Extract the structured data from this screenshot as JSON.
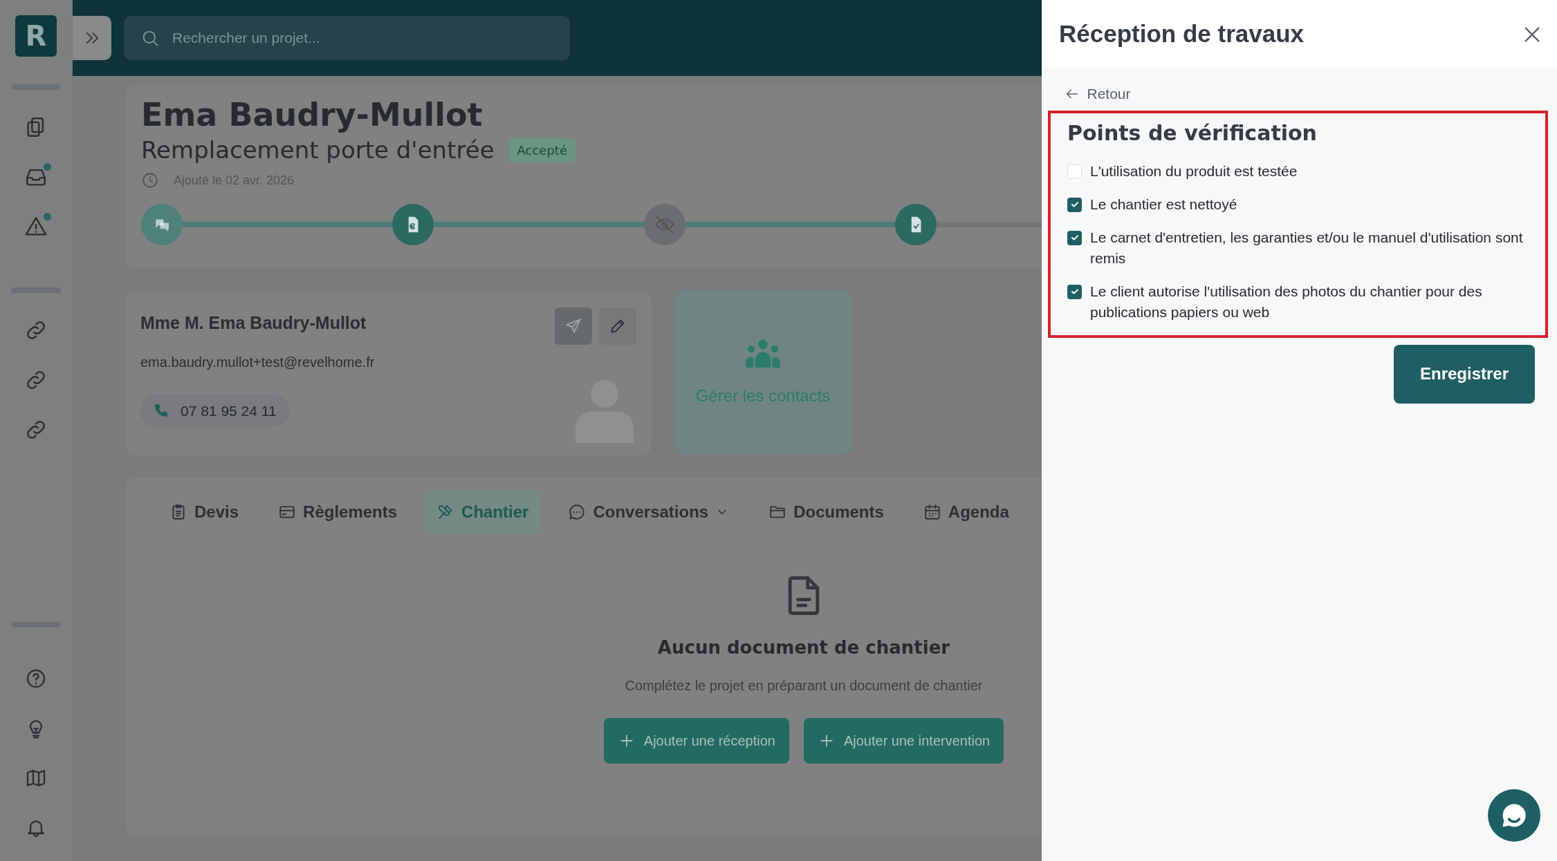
{
  "sidebar": {
    "logo": "R",
    "items": [
      {
        "notification": false
      },
      {
        "notification": true
      },
      {
        "notification": true
      },
      {
        "notification": false
      },
      {
        "notification": false
      },
      {
        "notification": false
      }
    ]
  },
  "search": {
    "placeholder": "Rechercher un projet..."
  },
  "project": {
    "client": "Ema Baudry-Mullot",
    "title": "Remplacement porte d'entrée",
    "status": "Accepté",
    "added": "Ajouté le 02 avr. 2026",
    "steps": [
      {
        "color": "#4f8178"
      },
      {
        "color": "#2a6a5f"
      },
      {
        "color": "#6b6e70"
      },
      {
        "color": "#2a6a5f"
      }
    ]
  },
  "contact": {
    "name": "Mme M. Ema Baudry-Mullot",
    "email": "ema.baudry.mullot+test@revelhome.fr",
    "phone": "07 81 95 24 11",
    "manage": "Gérer les contacts"
  },
  "tabs": [
    {
      "label": "Devis",
      "selected": false
    },
    {
      "label": "Règlements",
      "selected": false
    },
    {
      "label": "Chantier",
      "selected": true
    },
    {
      "label": "Conversations",
      "selected": false,
      "dropdown": true
    },
    {
      "label": "Documents",
      "selected": false
    },
    {
      "label": "Agenda",
      "selected": false
    }
  ],
  "empty_state": {
    "title": "Aucun document de chantier",
    "text": "Complétez le projet en préparant un document de chantier",
    "buttons": [
      "Ajouter une réception",
      "Ajouter une intervention"
    ]
  },
  "panel": {
    "title": "Réception de travaux",
    "back": "Retour",
    "section": "Points de vérification",
    "highlighted": true,
    "checks": [
      {
        "label": "L'utilisation du produit est testée",
        "checked": false
      },
      {
        "label": "Le chantier est nettoyé",
        "checked": true
      },
      {
        "label": "Le carnet d'entretien, les garanties et/ou le manuel d'utilisation sont remis",
        "checked": true
      },
      {
        "label": "Le client autorise l'utilisation des photos du chantier pour des publications papiers ou web",
        "checked": true
      }
    ],
    "save": "Enregistrer"
  }
}
